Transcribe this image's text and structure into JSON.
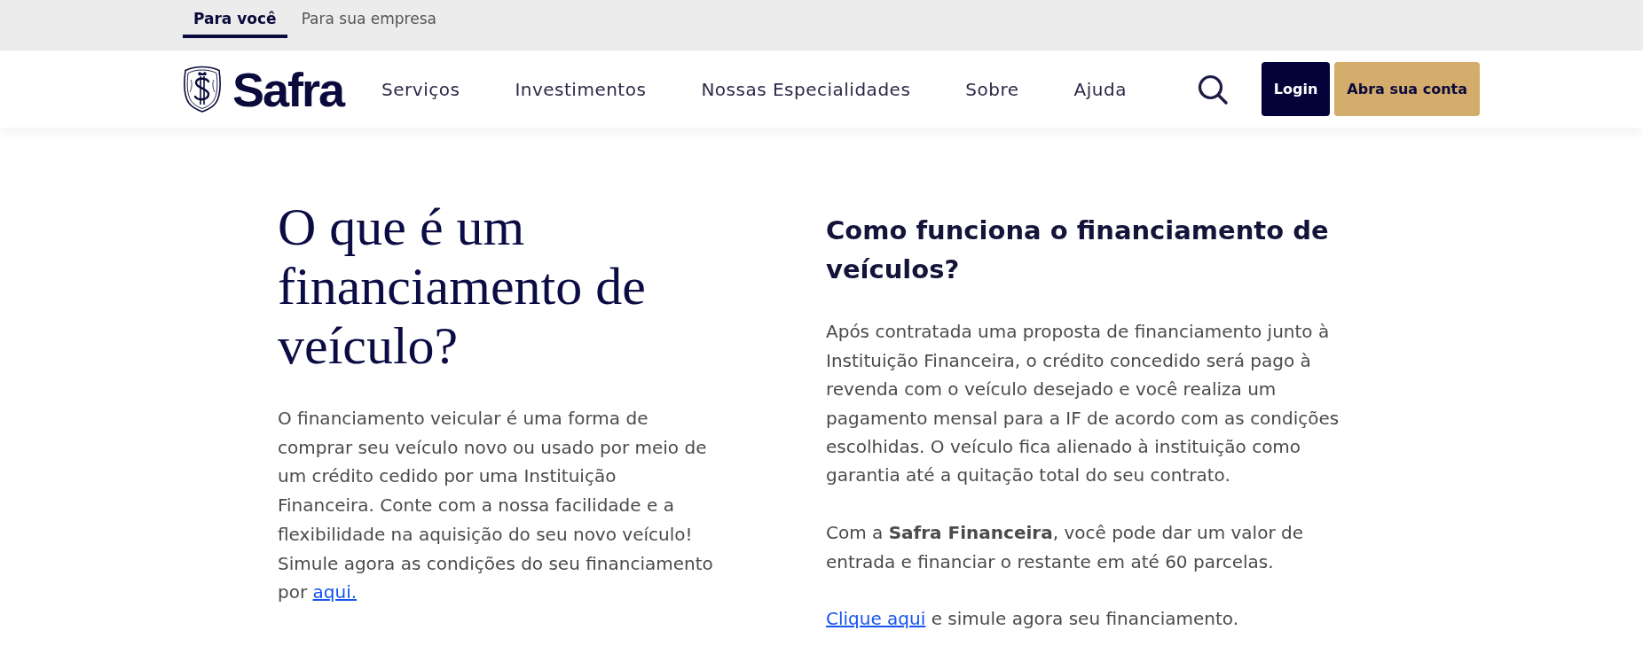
{
  "top_tabs": [
    {
      "label": "Para você",
      "selected": true
    },
    {
      "label": "Para sua empresa",
      "selected": false
    }
  ],
  "header": {
    "logo_text": "Safra",
    "nav_items": [
      "Serviços",
      "Investimentos",
      "Nossas Especialidades",
      "Sobre",
      "Ajuda"
    ],
    "buttons": [
      {
        "label": "Login",
        "kind": "primary"
      },
      {
        "label": "Abra sua conta",
        "kind": "accent"
      }
    ]
  },
  "left_section": {
    "heading": "O que é um financiamento de veículo?",
    "paragraphs": [
      {
        "parts": [
          {
            "kind": "text",
            "text": "O financiamento veicular é uma forma de comprar seu veículo novo ou usado por meio de um crédito cedido por uma Instituição Financeira. Conte com a nossa facilidade e a flexibilidade na aquisição do seu novo veículo! Simule agora as condições do seu financiamento por"
          },
          {
            "kind": "link",
            "text": "aqui."
          }
        ]
      }
    ]
  },
  "right_section": {
    "heading": "Como funciona o financiamento de veículos?",
    "paragraphs": [
      {
        "parts": [
          {
            "kind": "text",
            "text": "Após contratada uma proposta de financiamento junto à Instituição Financeira, o crédito concedido será pago à revenda com o veículo desejado e você realiza um pagamento mensal para a IF de acordo com as condições escolhidas. O veículo fica alienado à instituição como garantia até a quitação total do seu contrato."
          }
        ]
      },
      {
        "parts": [
          {
            "kind": "text",
            "text": "Com a **Safra Financeira**, você pode dar um valor de entrada e financiar o restante em até 60 parcelas."
          }
        ]
      },
      {
        "parts": [
          {
            "kind": "link",
            "text": "Clique aqui"
          },
          {
            "kind": "text",
            "text": "e simule agora seu financiamento."
          }
        ]
      }
    ]
  }
}
